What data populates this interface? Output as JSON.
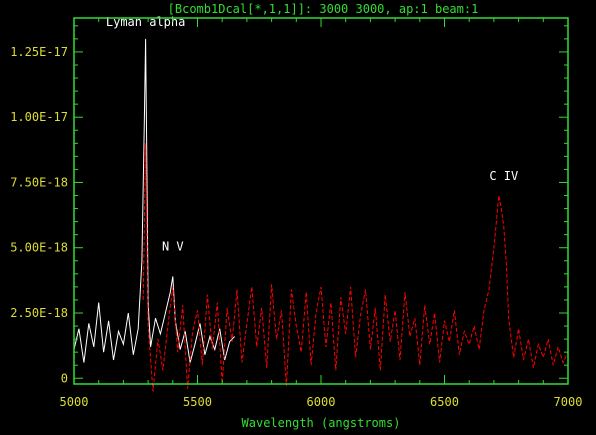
{
  "chart_data": {
    "type": "line",
    "title": "[Bcomb1Dcal[*,1,1]]: 3000 3000, ap:1 beam:1",
    "xlabel": "Wavelength (angstroms)",
    "ylabel": "",
    "xlim": [
      5000,
      7000
    ],
    "ylim": [
      -2.2e-19,
      1.38e-17
    ],
    "x_ticks": [
      5000,
      5500,
      6000,
      6500,
      7000
    ],
    "x_tick_labels": [
      "5000",
      "5500",
      "6000",
      "6500",
      "7000"
    ],
    "y_ticks": [
      0,
      2.5e-18,
      5e-18,
      7.5e-18,
      1e-17,
      1.25e-17
    ],
    "y_tick_labels": [
      "0",
      "2.50E-18",
      "5.00E-18",
      "7.50E-18",
      "1.00E-17",
      "1.25E-17"
    ],
    "grid": false,
    "annotations": [
      {
        "text": "Lyman alpha",
        "x": 5290,
        "y": 1.35e-17
      },
      {
        "text": "N V",
        "x": 5400,
        "y": 4.9e-18
      },
      {
        "text": "C IV",
        "x": 6740,
        "y": 7.6e-18
      }
    ],
    "series": [
      {
        "style": "solid",
        "color": "#ffffff",
        "x": [
          5000,
          5020,
          5040,
          5060,
          5080,
          5100,
          5120,
          5140,
          5160,
          5180,
          5200,
          5220,
          5240,
          5260,
          5275,
          5285,
          5290,
          5295,
          5300,
          5310,
          5330,
          5350,
          5370,
          5390,
          5400,
          5410,
          5430,
          5450,
          5470,
          5490,
          5510,
          5530,
          5550,
          5570,
          5590,
          5610,
          5630,
          5650
        ],
        "y": [
          1.1e-18,
          1.9e-18,
          6e-19,
          2.1e-18,
          1.2e-18,
          2.9e-18,
          1e-18,
          2.2e-18,
          7e-19,
          1.8e-18,
          1.3e-18,
          2.5e-18,
          9e-19,
          1.9e-18,
          4.5e-18,
          1e-17,
          1.3e-17,
          8e-18,
          2.9e-18,
          1.2e-18,
          2.3e-18,
          1.7e-18,
          2.5e-18,
          3.3e-18,
          3.9e-18,
          2.2e-18,
          1.1e-18,
          1.8e-18,
          6e-19,
          1.3e-18,
          2.1e-18,
          9e-19,
          1.6e-18,
          1.1e-18,
          1.9e-18,
          7e-19,
          1.4e-18,
          1.6e-18
        ]
      },
      {
        "style": "dashed",
        "color": "#ff0000",
        "x": [
          5280,
          5285,
          5290,
          5295,
          5300,
          5320,
          5340,
          5360,
          5380,
          5400,
          5420,
          5440,
          5460,
          5480,
          5500,
          5520,
          5540,
          5560,
          5580,
          5600,
          5620,
          5640,
          5660,
          5680,
          5700,
          5720,
          5740,
          5760,
          5780,
          5800,
          5820,
          5840,
          5860,
          5880,
          5900,
          5920,
          5940,
          5960,
          5980,
          6000,
          6020,
          6040,
          6060,
          6080,
          6100,
          6120,
          6140,
          6160,
          6180,
          6200,
          6220,
          6240,
          6260,
          6280,
          6300,
          6320,
          6340,
          6360,
          6380,
          6400,
          6420,
          6440,
          6460,
          6480,
          6500,
          6520,
          6540,
          6560,
          6580,
          6600,
          6620,
          6640,
          6660,
          6680,
          6700,
          6710,
          6720,
          6730,
          6740,
          6750,
          6760,
          6770,
          6780,
          6800,
          6820,
          6840,
          6860,
          6880,
          6900,
          6920,
          6940,
          6960,
          6980,
          7000
        ],
        "y": [
          3e-18,
          6e-18,
          9e-18,
          5.5e-18,
          2e-18,
          -5e-19,
          1.5e-18,
          3e-19,
          2e-18,
          3.5e-18,
          1e-18,
          2.8e-18,
          -4e-19,
          1.8e-18,
          2.6e-18,
          5e-19,
          3.2e-18,
          1.1e-18,
          2.9e-18,
          -2e-19,
          2.7e-18,
          1.4e-18,
          3.4e-18,
          6e-19,
          2.1e-18,
          3.5e-18,
          1.2e-18,
          2.7e-18,
          4e-19,
          3.6e-18,
          1.5e-18,
          2.6e-18,
          -3e-19,
          3.4e-18,
          2e-18,
          1e-18,
          3.3e-18,
          5e-19,
          2.5e-18,
          3.5e-18,
          1.2e-18,
          2.9e-18,
          3e-19,
          3.1e-18,
          1.7e-18,
          3.5e-18,
          8e-19,
          2.4e-18,
          3.4e-18,
          1.1e-18,
          2.7e-18,
          3e-19,
          3.2e-18,
          1.4e-18,
          2.6e-18,
          7e-19,
          3.3e-18,
          1.6e-18,
          2.3e-18,
          5e-19,
          2.8e-18,
          1.3e-18,
          2.5e-18,
          6e-19,
          2.2e-18,
          1.4e-18,
          2.6e-18,
          9e-19,
          1.8e-18,
          1.3e-18,
          2e-18,
          1.1e-18,
          2.6e-18,
          3.4e-18,
          5e-18,
          6e-18,
          7e-18,
          6.5e-18,
          5.8e-18,
          4.4e-18,
          2.3e-18,
          1.5e-18,
          8e-19,
          1.9e-18,
          7e-19,
          1.5e-18,
          4e-19,
          1.3e-18,
          8e-19,
          1.5e-18,
          5e-19,
          1.2e-18,
          6e-19,
          1e-18
        ]
      }
    ]
  }
}
